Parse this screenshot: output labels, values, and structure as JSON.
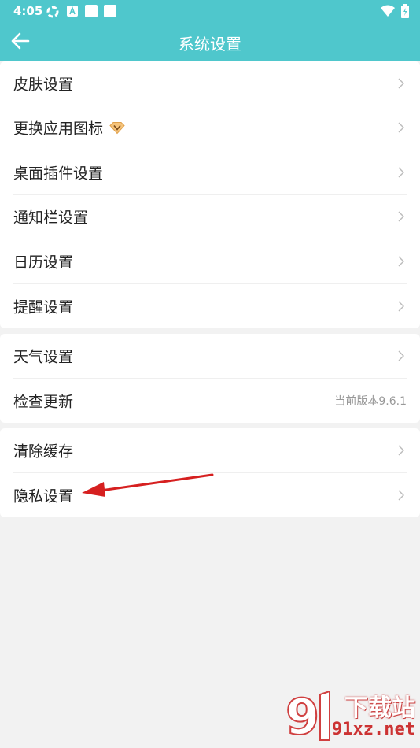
{
  "status_bar": {
    "time": "4:05"
  },
  "header": {
    "title": "系统设置"
  },
  "groups": [
    {
      "items": [
        {
          "label": "皮肤设置"
        },
        {
          "label": "更换应用图标"
        },
        {
          "label": "桌面插件设置"
        },
        {
          "label": "通知栏设置"
        },
        {
          "label": "日历设置"
        },
        {
          "label": "提醒设置"
        }
      ]
    },
    {
      "items": [
        {
          "label": "天气设置"
        },
        {
          "label": "检查更新",
          "value": "当前版本9.6.1"
        }
      ]
    },
    {
      "items": [
        {
          "label": "清除缓存"
        },
        {
          "label": "隐私设置"
        }
      ]
    }
  ],
  "watermark": {
    "brand": "下载站",
    "domain": "91xz.net"
  },
  "colors": {
    "header": "#4fc7cc",
    "background": "#f2f2f2",
    "annotation": "#d62020"
  }
}
